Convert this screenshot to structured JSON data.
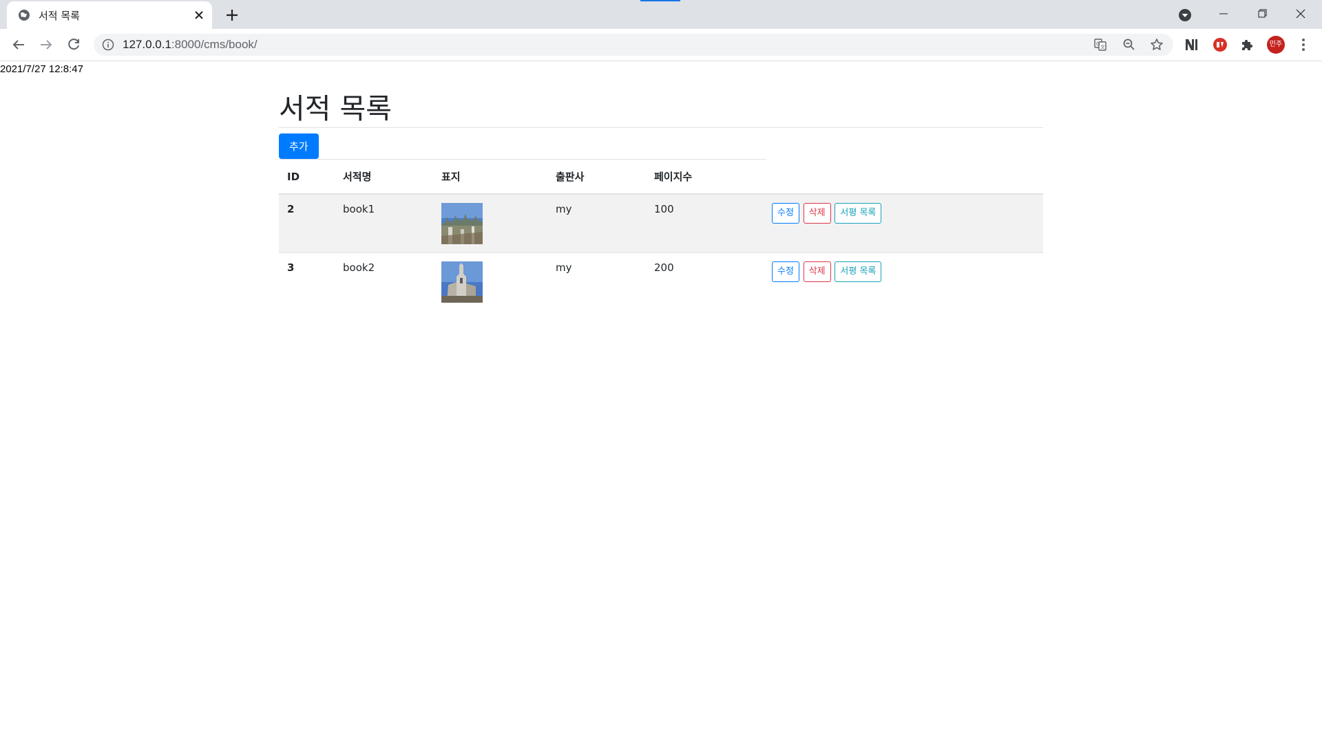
{
  "browser": {
    "tab_title": "서적 목록",
    "url_host": "127.0.0.1",
    "url_path": ":8000/cms/book/",
    "avatar_label": "민주",
    "icons": [
      "globe-icon",
      "close-icon",
      "plus-icon",
      "tab-search-icon",
      "minimize-icon",
      "restore-icon",
      "window-close-icon",
      "back-icon",
      "forward-icon",
      "reload-icon",
      "info-icon",
      "translate-icon",
      "zoom-icon",
      "star-icon",
      "extension-n-icon",
      "extension-red-icon",
      "extensions-puzzle-icon",
      "kebab-menu-icon"
    ]
  },
  "page": {
    "timestamp": "2021/7/27 12:8:47",
    "title": "서적 목록",
    "add_label": "추가",
    "columns": [
      "ID",
      "서적명",
      "표지",
      "출판사",
      "페이지수"
    ],
    "rows": [
      {
        "id": "2",
        "name": "book1",
        "cover": "photo of cityscape with blue sky",
        "publisher": "my",
        "pages": "100"
      },
      {
        "id": "3",
        "name": "book2",
        "cover": "photo of church tower with blue sky",
        "publisher": "my",
        "pages": "200"
      }
    ],
    "row_actions": {
      "edit": "수정",
      "delete": "삭제",
      "reviews": "서평 목록"
    }
  },
  "colors": {
    "primary": "#007bff",
    "danger": "#dc3545",
    "info": "#17a2b8",
    "stripe": "#f2f2f2"
  }
}
